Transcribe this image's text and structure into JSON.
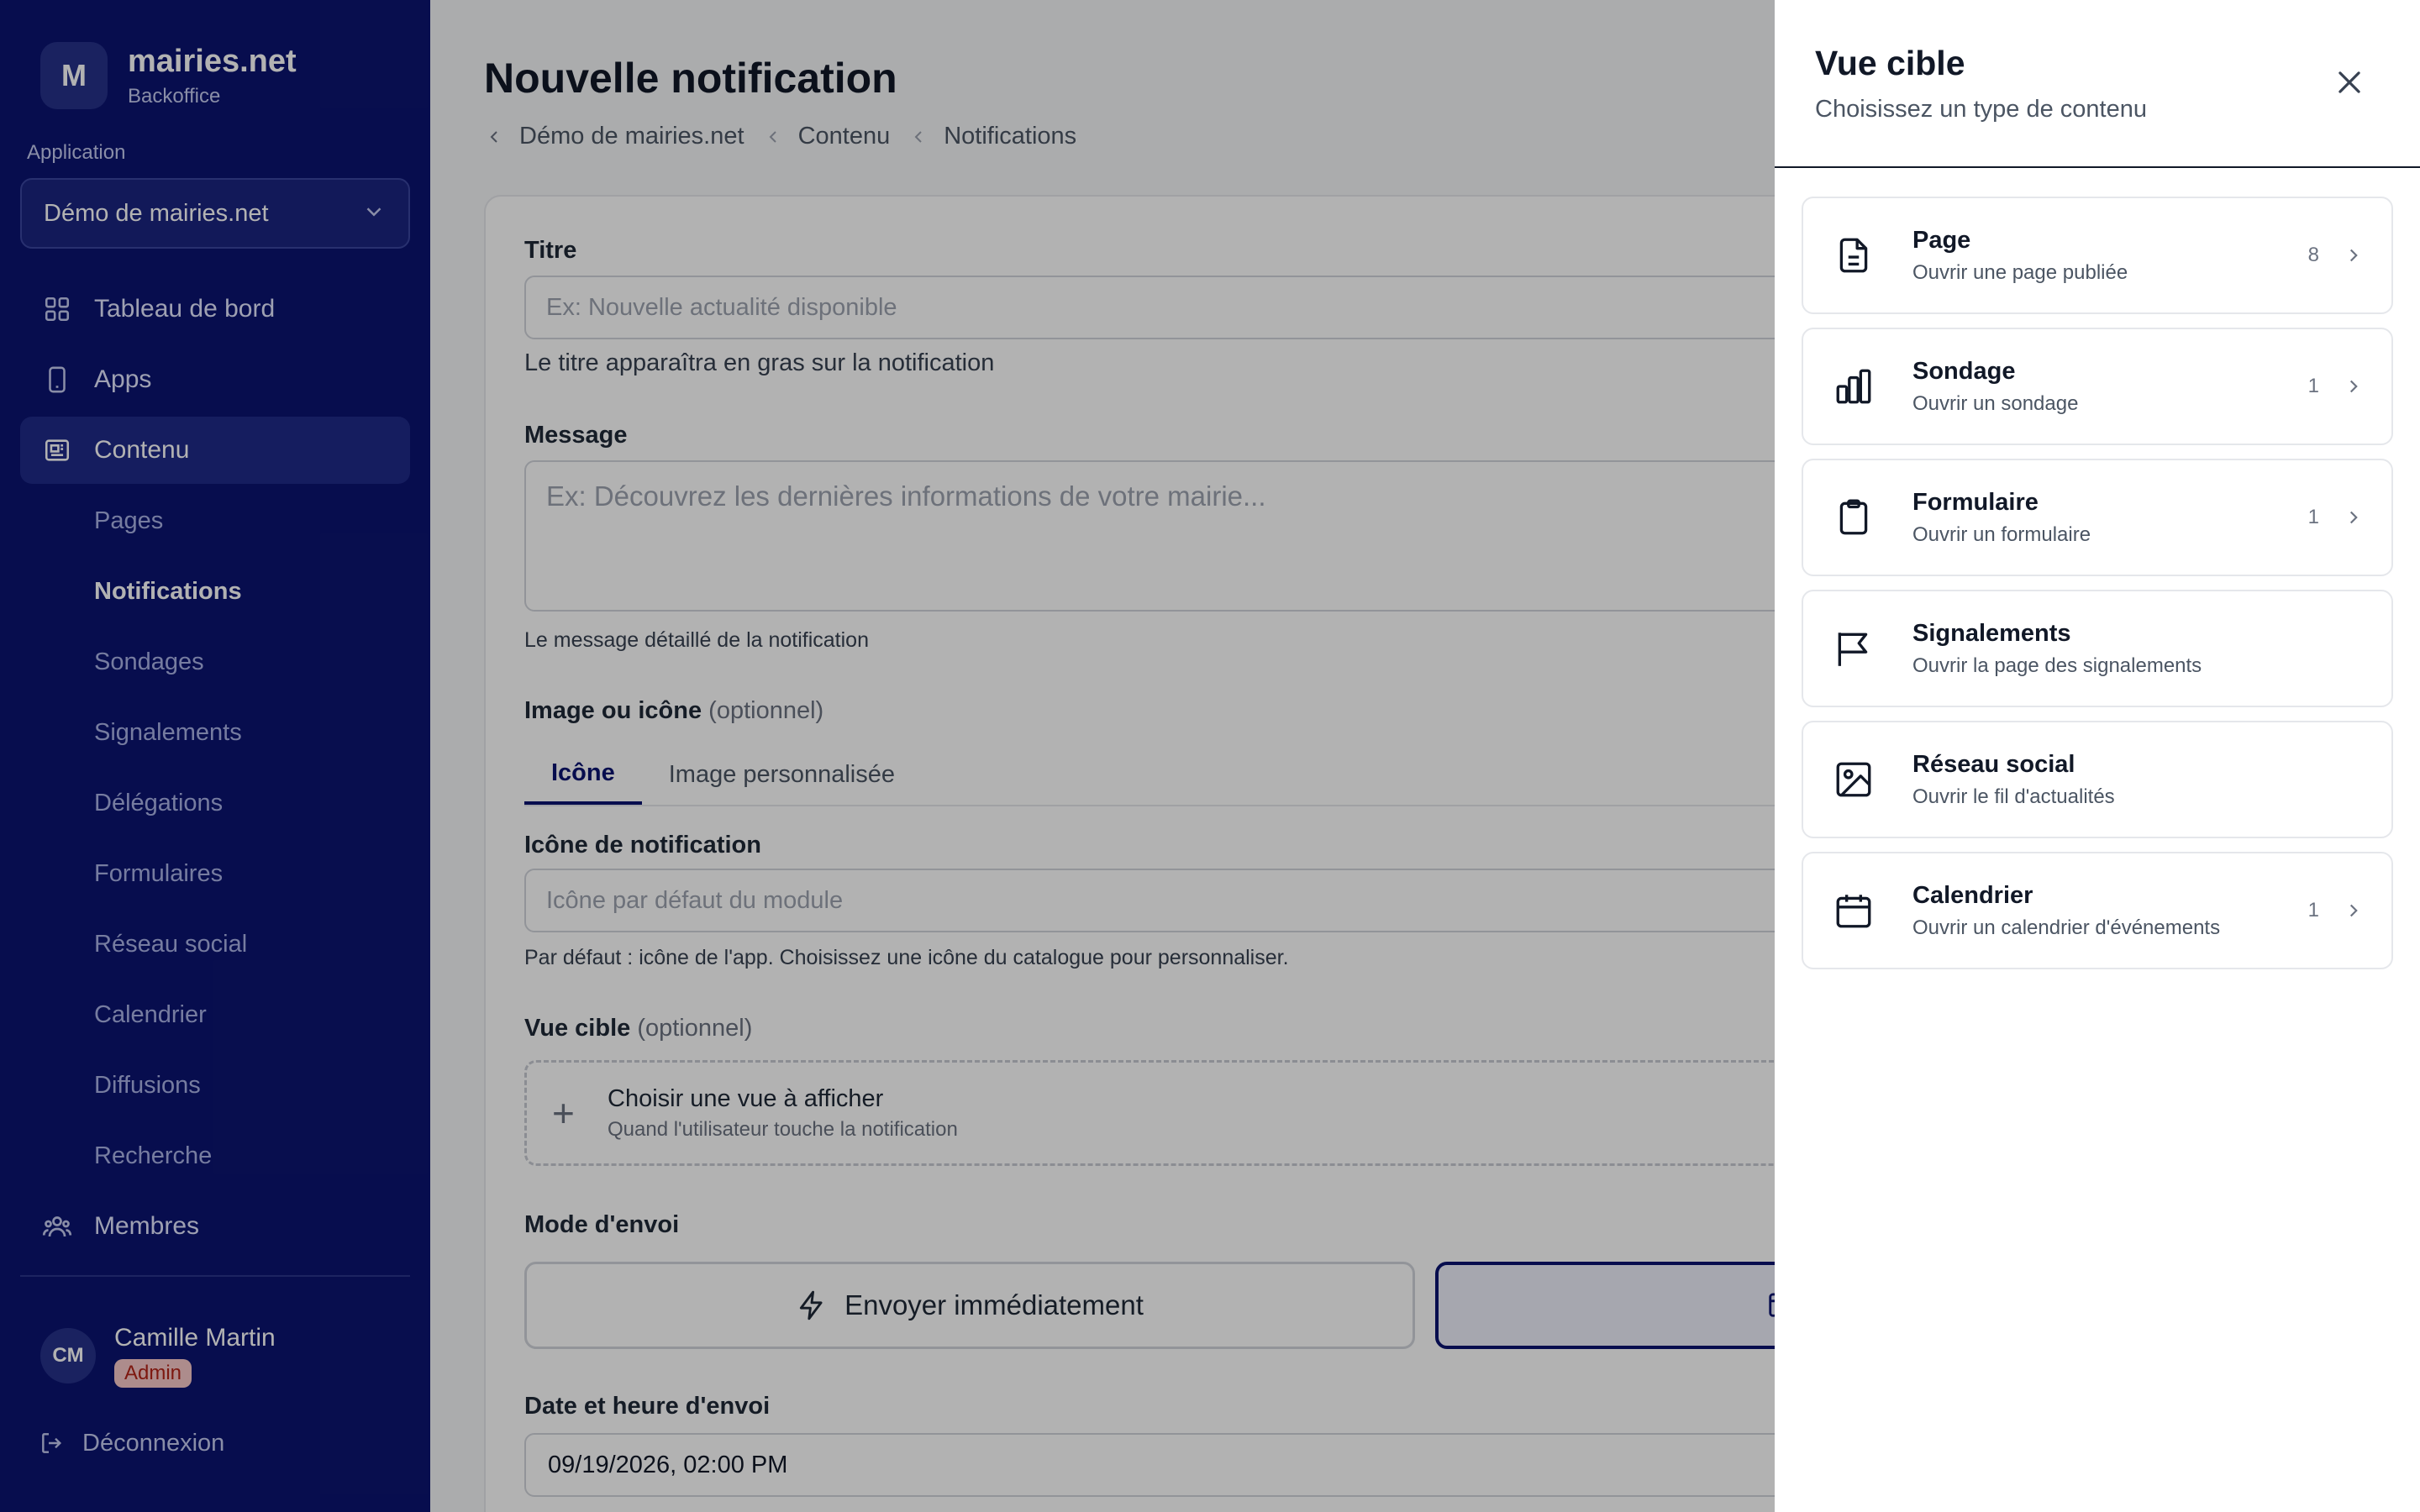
{
  "sidebar": {
    "brand": {
      "initial": "M",
      "name": "mairies.net",
      "sub": "Backoffice"
    },
    "app_label": "Application",
    "app_select": "Démo de mairies.net",
    "nav": [
      {
        "label": "Tableau de bord",
        "icon": "grid-icon"
      },
      {
        "label": "Apps",
        "icon": "phone-icon"
      },
      {
        "label": "Contenu",
        "icon": "newspaper-icon"
      }
    ],
    "sub_items": [
      "Pages",
      "Notifications",
      "Sondages",
      "Signalements",
      "Délégations",
      "Formulaires",
      "Réseau social",
      "Calendrier",
      "Diffusions",
      "Recherche"
    ],
    "members": "Membres",
    "user": {
      "initials": "CM",
      "name": "Camille Martin",
      "role": "Admin"
    },
    "logout": "Déconnexion"
  },
  "main": {
    "title": "Nouvelle notification",
    "breadcrumb": [
      "Démo de mairies.net",
      "Contenu",
      "Notifications"
    ],
    "form": {
      "title_label": "Titre",
      "title_placeholder": "Ex: Nouvelle actualité disponible",
      "title_help": "Le titre apparaîtra en gras sur la notification",
      "message_label": "Message",
      "message_placeholder": "Ex: Découvrez les dernières informations de votre mairie...",
      "message_help": "Le message détaillé de la notification",
      "image_label": "Image ou icône",
      "optional": "(optionnel)",
      "tabs": [
        "Icône",
        "Image personnalisée"
      ],
      "icon_label": "Icône de notification",
      "icon_placeholder": "Icône par défaut du module",
      "icon_help": "Par défaut : icône de l'app. Choisissez une icône du catalogue pour personnaliser.",
      "target_label": "Vue cible",
      "target_choose": "Choisir une vue à afficher",
      "target_choose_sub": "Quand l'utilisateur touche la notification",
      "send_mode_label": "Mode d'envoi",
      "send_now": "Envoyer immédiatement",
      "datetime_label": "Date et heure d'envoi",
      "datetime_value": "09/19/2026, 02:00 PM"
    }
  },
  "drawer": {
    "title": "Vue cible",
    "subtitle": "Choisissez un type de contenu",
    "options": [
      {
        "title": "Page",
        "desc": "Ouvrir une page publiée",
        "count": "8",
        "icon": "document-icon"
      },
      {
        "title": "Sondage",
        "desc": "Ouvrir un sondage",
        "count": "1",
        "icon": "bar-chart-icon"
      },
      {
        "title": "Formulaire",
        "desc": "Ouvrir un formulaire",
        "count": "1",
        "icon": "clipboard-icon"
      },
      {
        "title": "Signalements",
        "desc": "Ouvrir la page des signalements",
        "count": "",
        "icon": "flag-icon"
      },
      {
        "title": "Réseau social",
        "desc": "Ouvrir le fil d'actualités",
        "count": "",
        "icon": "image-icon"
      },
      {
        "title": "Calendrier",
        "desc": "Ouvrir un calendrier d'événements",
        "count": "1",
        "icon": "calendar-icon"
      }
    ]
  },
  "colors": {
    "sidebar_bg": "#0b1470",
    "accent": "#0b1470",
    "admin_badge": "#f8c9c9"
  }
}
